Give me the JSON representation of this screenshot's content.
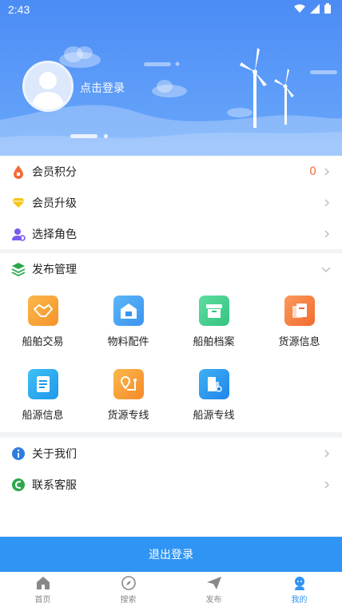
{
  "status_bar": {
    "time": "2:43"
  },
  "profile": {
    "login_label": "点击登录"
  },
  "account_menu": [
    {
      "label": "会员积分",
      "value": "0",
      "icon": "drop-icon",
      "color": "#f26b3a"
    },
    {
      "label": "会员升级",
      "icon": "diamond-icon",
      "color": "#f5c518"
    },
    {
      "label": "选择角色",
      "icon": "user-settings-icon",
      "color": "#7b5cf0"
    }
  ],
  "publish": {
    "title": "发布管理",
    "icon": "layers-icon",
    "items": [
      {
        "label": "船舶交易",
        "icon": "handshake-icon",
        "color": "#f5a623"
      },
      {
        "label": "物料配件",
        "icon": "warehouse-icon",
        "color": "#3fa0f0"
      },
      {
        "label": "船舶档案",
        "icon": "archive-icon",
        "color": "#3fcf8e"
      },
      {
        "label": "货源信息",
        "icon": "cargo-docs-icon",
        "color": "#f57c3a"
      },
      {
        "label": "船源信息",
        "icon": "document-list-icon",
        "color": "#2f94f4"
      },
      {
        "label": "货源专线",
        "icon": "route-pin-icon",
        "color": "#f5932a"
      },
      {
        "label": "船源专线",
        "icon": "ship-route-icon",
        "color": "#2f94f4"
      }
    ]
  },
  "info_menu": [
    {
      "label": "关于我们",
      "icon": "info-icon",
      "color": "#2f7de0"
    },
    {
      "label": "联系客服",
      "icon": "service-icon",
      "color": "#2aa84a"
    }
  ],
  "logout_label": "退出登录",
  "tabbar": [
    {
      "label": "首页",
      "icon": "home-icon"
    },
    {
      "label": "搜索",
      "icon": "compass-icon"
    },
    {
      "label": "发布",
      "icon": "send-icon"
    },
    {
      "label": "我的",
      "icon": "profile-icon",
      "active": true
    }
  ]
}
